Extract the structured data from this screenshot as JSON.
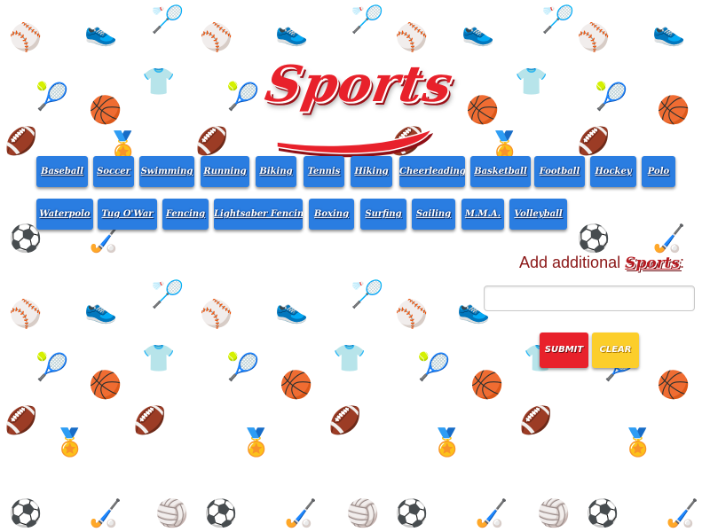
{
  "header": {
    "logo_text": "Sports"
  },
  "sports": {
    "row1": [
      "Baseball",
      "Soccer",
      "Swimming",
      "Running",
      "Biking",
      "Tennis",
      "Hiking",
      "Cheerleading",
      "Basketball",
      "Football",
      "Hockey",
      "Polo"
    ],
    "row2": [
      "Waterpolo",
      "Tug O'War",
      "Fencing",
      "Lightsaber Fencing",
      "Boxing",
      "Surfing",
      "Sailing",
      "M.M.A.",
      "Volleyball"
    ]
  },
  "add_form": {
    "label_prefix": "Add additional ",
    "label_script": "Sports",
    "label_suffix": ":",
    "input_value": "",
    "input_placeholder": ""
  },
  "actions": {
    "submit_label": "SUBMIT",
    "clear_label": "CLEAR"
  },
  "colors": {
    "button_blue": "#2a7de1",
    "submit_red": "#e8212b",
    "clear_yellow": "#fcce2b",
    "label_dark_red": "#8a1616"
  },
  "background_icons": [
    "baseball-icon",
    "sneaker-icon",
    "badminton-icon",
    "tennis-racket-icon",
    "jersey-icon",
    "basketball-icon",
    "football-icon",
    "medal-icon",
    "hockey-sticks-icon",
    "volleyball-icon",
    "soccer-ball-icon"
  ]
}
